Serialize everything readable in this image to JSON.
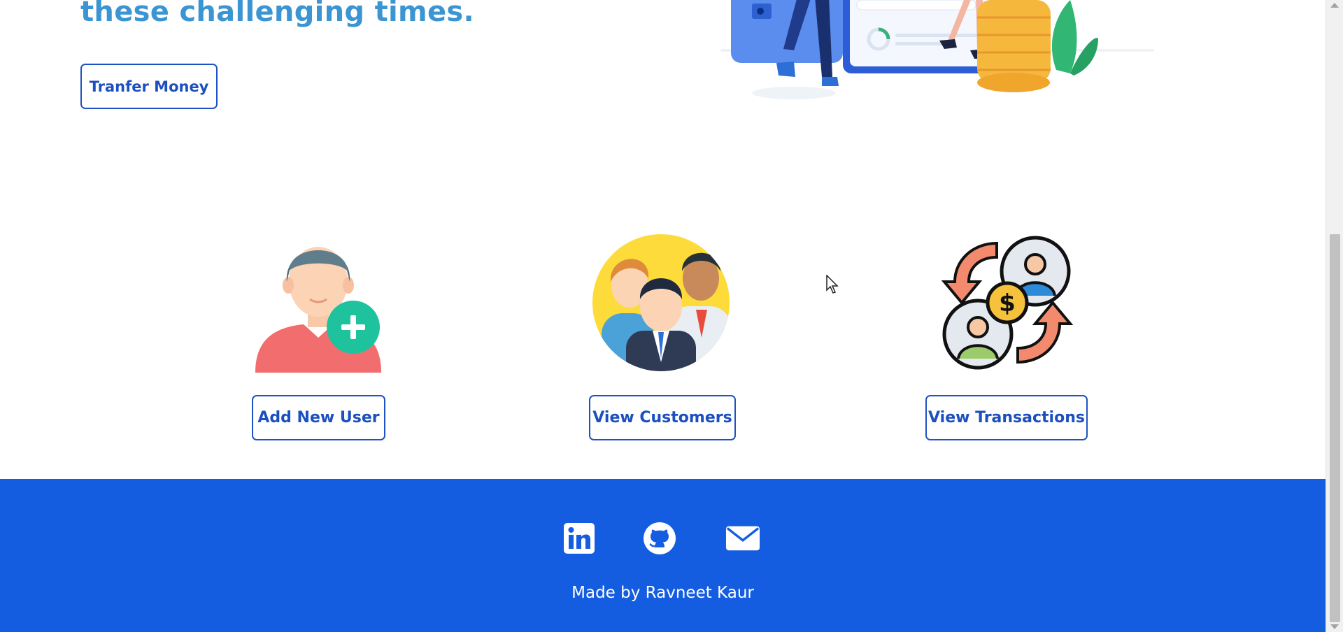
{
  "hero": {
    "heading_line": "these challenging times.",
    "transfer_button": "Tranfer Money"
  },
  "features": [
    {
      "icon": "add-user-icon",
      "button": "Add New User"
    },
    {
      "icon": "customers-icon",
      "button": "View Customers"
    },
    {
      "icon": "transactions-icon",
      "button": "View Transactions"
    }
  ],
  "footer": {
    "icons": [
      "linkedin-icon",
      "github-icon",
      "mail-icon"
    ],
    "credit": "Made by Ravneet Kaur"
  },
  "colors": {
    "primary": "#1e53c3",
    "heading": "#3b95d2",
    "footer_bg": "#145ce0"
  }
}
